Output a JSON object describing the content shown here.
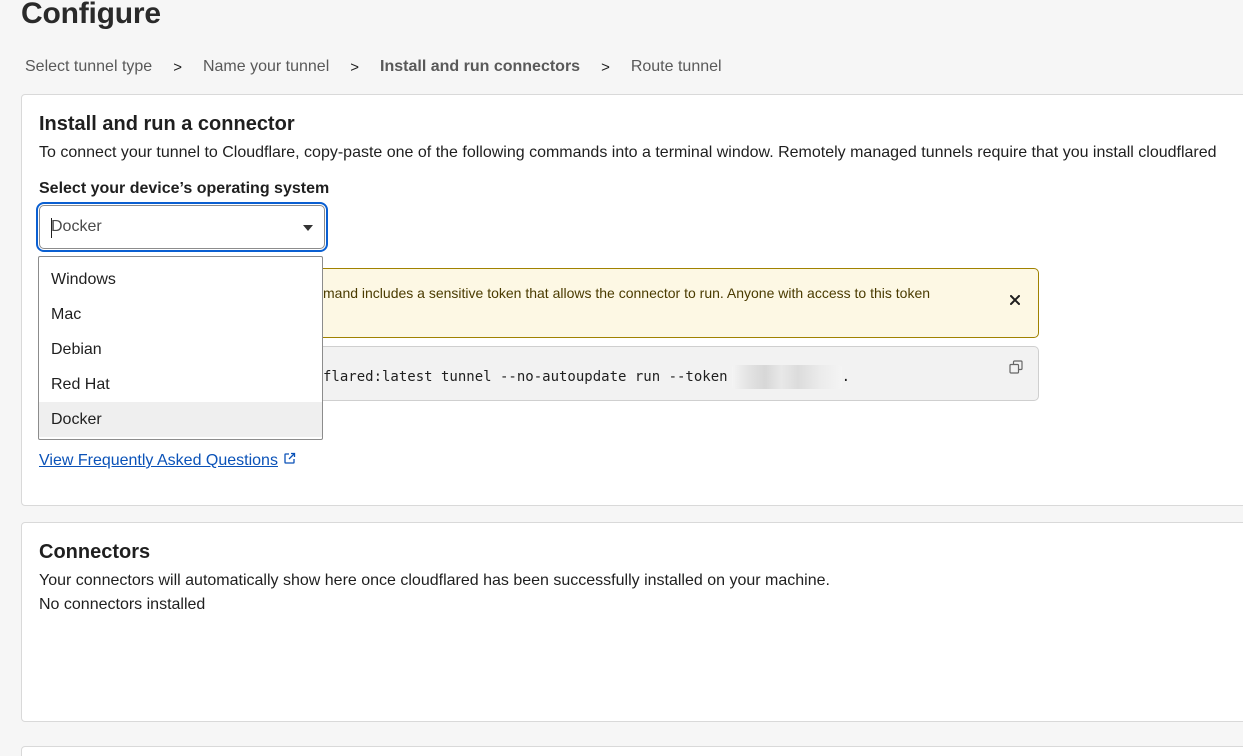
{
  "page": {
    "title": "Configure"
  },
  "breadcrumb": {
    "steps": [
      "Select tunnel type",
      "Name your tunnel",
      "Install and run connectors",
      "Route tunnel"
    ],
    "separator": ">",
    "active_index": 2
  },
  "install_card": {
    "title": "Install and run a connector",
    "description": "To connect your tunnel to Cloudflare, copy-paste one of the following commands into a terminal window. Remotely managed tunnels require that you install cloudflared",
    "os_label": "Select your device’s operating system",
    "os_selected": "Docker",
    "os_options": [
      "Windows",
      "Mac",
      "Debian",
      "Red Hat",
      "Docker"
    ],
    "warning_text": "mand includes a sensitive token that allows the connector to run. Anyone with access to this token",
    "command_text": "flared:latest tunnel --no-autoupdate run --token",
    "command_suffix": ".",
    "faq_link": "View Frequently Asked Questions"
  },
  "connectors_card": {
    "title": "Connectors",
    "description": "Your connectors will automatically show here once cloudflared has been successfully installed on your machine.",
    "empty_text": "No connectors installed"
  },
  "icons": {
    "dropdown": "chevron-down-icon",
    "close": "close-icon",
    "copy": "copy-icon",
    "external": "external-link-icon"
  },
  "colors": {
    "focus_ring": "#0a5fd1",
    "link": "#0a52b8",
    "warning_bg": "#fdf8e4",
    "warning_border": "#a08200"
  }
}
